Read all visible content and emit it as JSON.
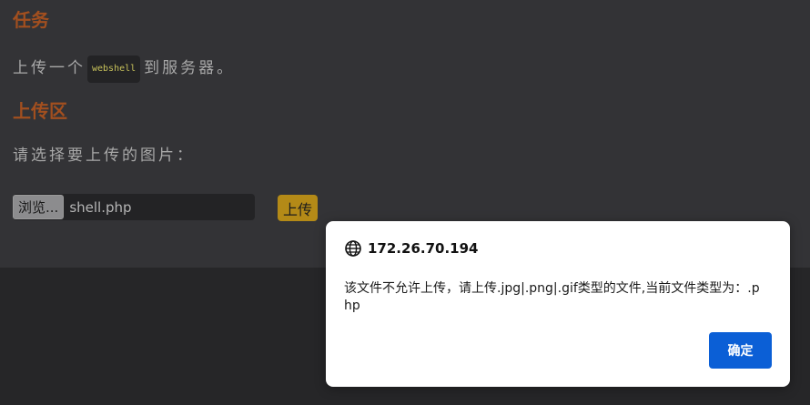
{
  "page": {
    "task_heading": "任务",
    "task_text_before": "上传一个",
    "task_code": "webshell",
    "task_text_after": "到服务器。",
    "upload_heading": "上传区",
    "choose_prompt": "请选择要上传的图片：",
    "browse_label": "浏览...",
    "selected_file": "shell.php",
    "upload_label": "上传"
  },
  "dialog": {
    "origin": "172.26.70.194",
    "message": "该文件不允许上传，请上传.jpg|.png|.gif类型的文件,当前文件类型为：.php",
    "ok_label": "确定",
    "icon": "globe-icon"
  },
  "colors": {
    "heading": "#a24f1f",
    "background": "#333336",
    "overlay": "#262628",
    "upload_button": "#b48a17",
    "dialog_button": "#0b5fd6"
  }
}
